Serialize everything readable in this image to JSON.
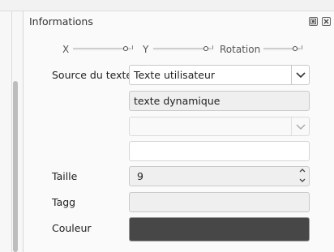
{
  "panel": {
    "title": "Informations",
    "float_icon": "float-icon",
    "close_icon": "close-icon"
  },
  "sliders": [
    {
      "label": "X",
      "level": 0.85
    },
    {
      "label": "Y",
      "level": 0.85
    },
    {
      "label": "Rotation",
      "level": 0.85
    }
  ],
  "form": {
    "source_label": "Source du texte",
    "source_value": "Texte utilisateur",
    "text_value": "texte dynamique",
    "dropdown2_value": "",
    "field4_value": "",
    "size_label": "Taille",
    "size_value": "9",
    "tag_label": "Tagg",
    "tag_value": "",
    "color_label": "Couleur",
    "color_value": "#474747"
  }
}
